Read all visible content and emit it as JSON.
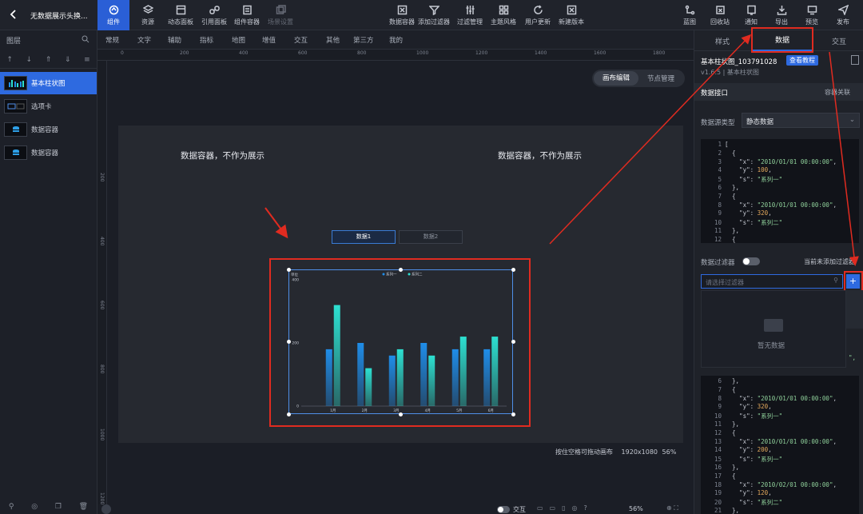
{
  "header": {
    "back_icon": "arrow-left-icon",
    "project_title": "无数据展示头换...",
    "tools_left": [
      {
        "label": "组件",
        "icon": "component-icon",
        "active": true
      },
      {
        "label": "资源",
        "icon": "layers-icon"
      },
      {
        "label": "动态面板",
        "icon": "panel-icon"
      },
      {
        "label": "引用面板",
        "icon": "link-icon"
      },
      {
        "label": "组件容器",
        "icon": "container-icon"
      },
      {
        "label": "场景设置",
        "icon": "scene-icon",
        "disabled": true
      }
    ],
    "tools_mid": [
      {
        "label": "数据容器",
        "icon": "data-container-icon"
      },
      {
        "label": "添加过滤器",
        "icon": "filter-icon"
      },
      {
        "label": "过滤管理",
        "icon": "filter-manage-icon"
      },
      {
        "label": "主题风格",
        "icon": "theme-icon"
      },
      {
        "label": "用户更新",
        "icon": "refresh-icon"
      },
      {
        "label": "新建版本",
        "icon": "version-icon"
      }
    ],
    "tools_right": [
      {
        "label": "蓝图",
        "icon": "blueprint-icon"
      },
      {
        "label": "回收站",
        "icon": "trash-icon"
      },
      {
        "label": "通知",
        "icon": "bell-icon"
      },
      {
        "label": "导出",
        "icon": "export-icon"
      },
      {
        "label": "预览",
        "icon": "preview-icon"
      },
      {
        "label": "发布",
        "icon": "send-icon"
      }
    ]
  },
  "layers": {
    "title": "图层",
    "items": [
      {
        "label": "基本柱状图",
        "selected": true
      },
      {
        "label": "选项卡"
      },
      {
        "label": "数据容器"
      },
      {
        "label": "数据容器"
      }
    ]
  },
  "categories": [
    "常规",
    "文字",
    "辅助",
    "指标",
    "地图",
    "增值",
    "交互",
    "其他",
    "第三方",
    "我的"
  ],
  "ruler": {
    "h_ticks": [
      "0",
      "200",
      "400",
      "600",
      "800",
      "1000",
      "1200",
      "1400",
      "1600",
      "1800"
    ],
    "v_ticks": [
      "200",
      "400",
      "600",
      "800",
      "1000",
      "1200"
    ]
  },
  "canvas": {
    "mode_tabs": [
      "画布编辑",
      "节点管理"
    ],
    "text_left": "数据容器，不作为展示",
    "text_right": "数据容器，不作为展示",
    "tabs": [
      "数据1",
      "数据2"
    ],
    "footer_text": "按住空格可拖动画布",
    "resolution": "1920x1080",
    "zoom_pct": "56%"
  },
  "chart_data": {
    "type": "bar",
    "ylabel": "单位",
    "ylim": [
      0,
      400
    ],
    "y_ticks": [
      "400",
      "200",
      "0"
    ],
    "categories": [
      "1月",
      "2月",
      "3月",
      "4月",
      "5月",
      "6月"
    ],
    "series": [
      {
        "name": "系列一",
        "color": "#1f8de8",
        "values": [
          180,
          200,
          160,
          200,
          180,
          180
        ]
      },
      {
        "name": "系列二",
        "color": "#2de0d1",
        "values": [
          320,
          120,
          180,
          160,
          220,
          220
        ]
      }
    ]
  },
  "statusbar": {
    "toggle_label": "交互",
    "zoom": "56%"
  },
  "panel": {
    "tabs": [
      "样式",
      "数据",
      "交互"
    ],
    "active_tab": "数据",
    "component_name": "基本柱状图_103791028",
    "view_tutorial": "查看教程",
    "version": "v1.6.5 | 基本柱状图",
    "section_title": "数据接口",
    "section_link": "容器关联",
    "source_label": "数据源类型",
    "source_value": "静态数据",
    "filter_label": "数据过滤器",
    "filter_status": "当前未添加过滤器",
    "filter_placeholder": "请选择过滤器",
    "empty_text": "暂无数据"
  },
  "json_top": [
    {
      "ln": "1",
      "text": "["
    },
    {
      "ln": "2",
      "text": "  {"
    },
    {
      "ln": "3",
      "key": "\"x\"",
      "val": "\"2010/01/01 00:00:00\"",
      "tail": ","
    },
    {
      "ln": "4",
      "key": "\"y\"",
      "num": "100",
      "tail": ","
    },
    {
      "ln": "5",
      "key": "\"s\"",
      "val": "\"系列一\""
    },
    {
      "ln": "6",
      "text": "  },"
    },
    {
      "ln": "7",
      "text": "  {"
    },
    {
      "ln": "8",
      "key": "\"x\"",
      "val": "\"2010/01/01 00:00:00\"",
      "tail": ","
    },
    {
      "ln": "9",
      "key": "\"y\"",
      "num": "320",
      "tail": ","
    },
    {
      "ln": "10",
      "key": "\"s\"",
      "val": "\"系列二\""
    },
    {
      "ln": "11",
      "text": "  },"
    },
    {
      "ln": "12",
      "text": "  {"
    }
  ],
  "json_bottom": [
    {
      "ln": "6",
      "text": "  },"
    },
    {
      "ln": "7",
      "text": "  {"
    },
    {
      "ln": "8",
      "key": "\"x\"",
      "val": "\"2010/01/01 00:00:00\"",
      "tail": ","
    },
    {
      "ln": "9",
      "key": "\"y\"",
      "num": "320",
      "tail": ","
    },
    {
      "ln": "10",
      "key": "\"s\"",
      "val": "\"系列一\""
    },
    {
      "ln": "11",
      "text": "  },"
    },
    {
      "ln": "12",
      "text": "  {"
    },
    {
      "ln": "13",
      "key": "\"x\"",
      "val": "\"2010/01/01 00:00:00\"",
      "tail": ","
    },
    {
      "ln": "14",
      "key": "\"y\"",
      "num": "200",
      "tail": ","
    },
    {
      "ln": "15",
      "key": "\"s\"",
      "val": "\"系列一\""
    },
    {
      "ln": "16",
      "text": "  },"
    },
    {
      "ln": "17",
      "text": "  {"
    },
    {
      "ln": "18",
      "key": "\"x\"",
      "val": "\"2010/02/01 00:00:00\"",
      "tail": ","
    },
    {
      "ln": "19",
      "key": "\"y\"",
      "num": "120",
      "tail": ","
    },
    {
      "ln": "20",
      "key": "\"s\"",
      "val": "\"系列二\""
    },
    {
      "ln": "21",
      "text": "  },"
    }
  ],
  "accent_color": "#2e6ae0",
  "annotation_color": "#e02b20"
}
